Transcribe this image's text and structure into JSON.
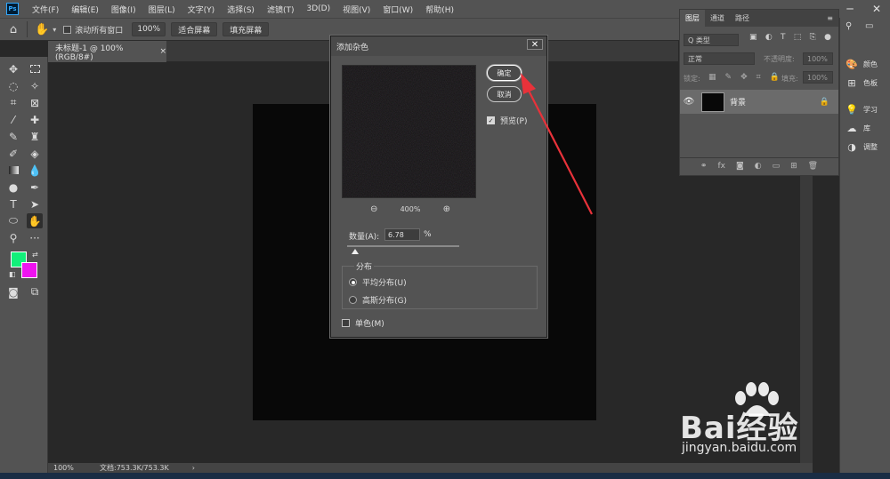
{
  "menubar": {
    "logo": "Ps",
    "items": [
      "文件(F)",
      "编辑(E)",
      "图像(I)",
      "图层(L)",
      "文字(Y)",
      "选择(S)",
      "滤镜(T)",
      "3D(D)",
      "视图(V)",
      "窗口(W)",
      "帮助(H)"
    ],
    "minimize": "─",
    "close": "✕"
  },
  "options": {
    "scroll_all_label": "滚动所有窗口",
    "zoom_value": "100%",
    "fit_screen_label": "适合屏幕",
    "fill_screen_label": "填充屏幕"
  },
  "document": {
    "tab_title": "未标题-1 @ 100%(RGB/8#)",
    "tab_close": "×",
    "canvas_color": "#080808"
  },
  "colors": {
    "foreground": "#12f07a",
    "background": "#ee12f0",
    "accent": "#e8323a"
  },
  "status": {
    "zoom": "100%",
    "doc_info": "文档:753.3K/753.3K",
    "arrow": "›"
  },
  "layers_panel": {
    "tabs": [
      "图层",
      "通道",
      "路径"
    ],
    "kind_label": "Q 类型",
    "blend_mode": "正常",
    "opacity_label": "不透明度:",
    "opacity_value": "100%",
    "lock_label": "锁定:",
    "fill_label": "填充:",
    "fill_value": "100%",
    "layer_name": "背景"
  },
  "right_dock": {
    "items": [
      "颜色",
      "色板",
      "学习",
      "库",
      "调整"
    ]
  },
  "dialog": {
    "title": "添加杂色",
    "close": "✕",
    "ok_label": "确定",
    "cancel_label": "取消",
    "preview_label": "预览(P)",
    "preview_checked": true,
    "zoom_level": "400%",
    "amount_label": "数量(A):",
    "amount_value": "6.78",
    "amount_unit": "%",
    "amount_slider_fraction": 0.0678,
    "distribution_title": "分布",
    "uniform_label": "平均分布(U)",
    "gaussian_label": "高斯分布(G)",
    "selected_distribution": "uniform",
    "monochrome_label": "单色(M)",
    "monochrome_checked": false
  },
  "watermark": {
    "brand": "Bai经验",
    "url": "jingyan.baidu.com"
  }
}
